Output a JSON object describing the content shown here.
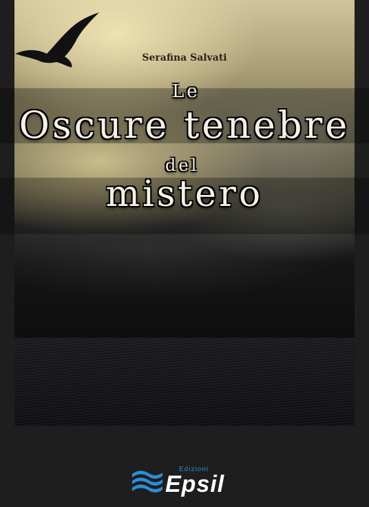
{
  "cover": {
    "author": "Serafina Salvati",
    "title_line1": "Le",
    "title_line2": "Oscure tenebre",
    "title_line3": "del",
    "title_line4": "mistero"
  },
  "publisher": {
    "prefix": "Edizioni",
    "name": "Epsil",
    "logo_icon": "waves-logo-icon"
  },
  "colors": {
    "background": "#1e1e1e",
    "title_text": "#f4f0e6",
    "publisher_accent": "#2a8fd6"
  }
}
